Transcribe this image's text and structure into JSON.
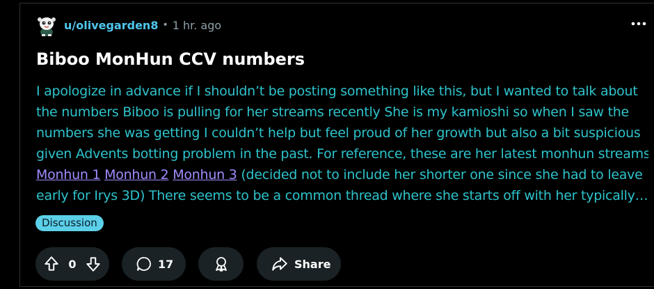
{
  "post": {
    "author": "u/olivegarden8",
    "separator": "•",
    "time": "1 hr. ago",
    "more_glyph": "•••",
    "title": "Biboo MonHun CCV numbers",
    "body_lines": [
      "I apologize in advance if I shouldn’t be posting something like this, but I wanted to talk about",
      "the numbers Biboo is pulling for her streams recently She is my kamioshi so when I saw the",
      "numbers she was getting I couldn’t help but feel proud of her growth but also a bit suspicious",
      "given Advents botting problem in the past. For reference, these are her latest monhun streams"
    ],
    "links": [
      "Monhun 1",
      "Monhun 2",
      "Monhun 3"
    ],
    "line5_tail": "(decided not to include her shorter one since she had to leave",
    "line6": "early for Irys 3D) There seems to be a common thread where she starts off with her typically…",
    "flair": "Discussion"
  },
  "actions": {
    "vote_count": "0",
    "comment_count": "17",
    "share_label": "Share"
  },
  "colors": {
    "background": "#000000",
    "username": "#4fc6ee",
    "body_text": "#2ec4cc",
    "link": "#a38cff",
    "flair_bg": "#5bd0e8",
    "button_bg": "#1a2226"
  },
  "icons": {
    "avatar": "snoo-avatar",
    "more": "more-options-icon",
    "upvote": "upvote-arrow-icon",
    "downvote": "downvote-arrow-icon",
    "comment": "comment-bubble-icon",
    "award": "award-icon",
    "share": "share-arrow-icon"
  }
}
